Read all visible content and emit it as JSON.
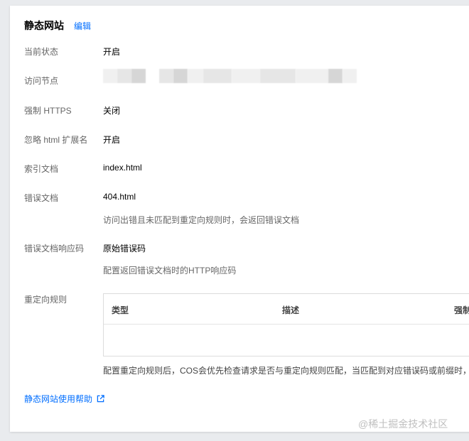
{
  "header": {
    "title": "静态网站",
    "edit_label": "编辑"
  },
  "rows": {
    "status": {
      "label": "当前状态",
      "value": "开启"
    },
    "endpoint": {
      "label": "访问节点"
    },
    "force_https": {
      "label": "强制 HTTPS",
      "value": "关闭"
    },
    "ignore_html": {
      "label": "忽略 html 扩展名",
      "value": "开启"
    },
    "index_doc": {
      "label": "索引文档",
      "value": "index.html"
    },
    "error_doc": {
      "label": "错误文档",
      "value": "404.html",
      "hint": "访问出错且未匹配到重定向规则时，会返回错误文档"
    },
    "error_code": {
      "label": "错误文档响应码",
      "value": "原始错误码",
      "hint": "配置返回错误文档时的HTTP响应码"
    },
    "redirect": {
      "label": "重定向规则"
    }
  },
  "rules_table": {
    "columns": [
      "类型",
      "描述",
      "强制"
    ],
    "note": "配置重定向规则后，COS会优先检查请求是否与重定向规则匹配，当匹配到对应错误码或前缀时，"
  },
  "help_link": {
    "label": "静态网站使用帮助",
    "icon": "external-link-icon"
  },
  "watermark": "@稀土掘金技术社区",
  "colors": {
    "link": "#006eff",
    "label": "#666666",
    "value": "#000000"
  }
}
